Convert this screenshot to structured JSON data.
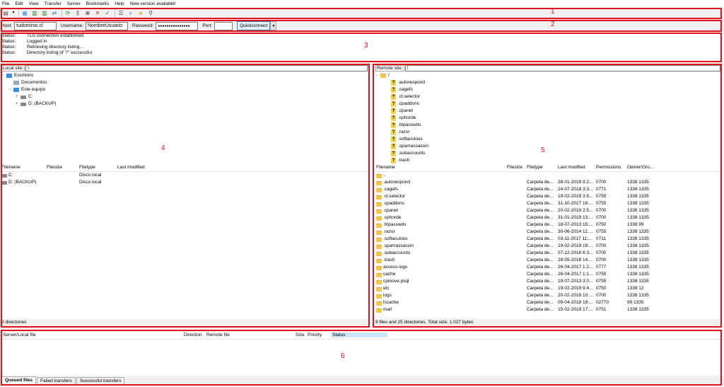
{
  "menu": [
    "File",
    "Edit",
    "View",
    "Transfer",
    "Server",
    "Bookmarks",
    "Help",
    "New version available!"
  ],
  "toolbar_icons": [
    "site-manager-icon",
    "dropdown-icon",
    "message-log-icon",
    "local-tree-icon",
    "remote-tree-icon",
    "transfer-queue-icon",
    "refresh-icon",
    "process-queue-icon",
    "cancel-icon",
    "disconnect-icon",
    "reconnect-icon",
    "filter-icon",
    "compare-icon",
    "sync-browse-icon",
    "search-icon"
  ],
  "quickconnect": {
    "host_label": "Host:",
    "host_value": "tudominio.cl",
    "user_label": "Username:",
    "user_value": "NombreUsuario",
    "pass_label": "Password:",
    "pass_value": "●●●●●●●●●●●●●●●",
    "port_label": "Port:",
    "port_value": "",
    "button": "Quickconnect"
  },
  "log": [
    {
      "k": "Status:",
      "v": "TLS connection established."
    },
    {
      "k": "Status:",
      "v": "Logged in"
    },
    {
      "k": "Status:",
      "v": "Retrieving directory listing..."
    },
    {
      "k": "Status:",
      "v": "Directory listing of \"/\" successful"
    }
  ],
  "local": {
    "site_label": "Local site:",
    "path": "\\",
    "tree": [
      {
        "name": "Escritorio",
        "icon": "pc",
        "lvl": 0,
        "exp": "−"
      },
      {
        "name": "Documentos",
        "icon": "doc",
        "lvl": 1,
        "exp": ""
      },
      {
        "name": "Este equipo",
        "icon": "pc",
        "lvl": 1,
        "exp": "−"
      },
      {
        "name": "C:",
        "icon": "drive",
        "lvl": 2,
        "exp": "+"
      },
      {
        "name": "D: (BACKUP)",
        "icon": "drive",
        "lvl": 2,
        "exp": "+"
      }
    ],
    "columns": [
      "Filename",
      "Filesize",
      "Filetype",
      "Last modified"
    ],
    "rows": [
      {
        "name": "C:",
        "type": "Disco local"
      },
      {
        "name": "D: (BACKUP)",
        "type": "Disco local"
      }
    ],
    "status": "2 directories"
  },
  "remote": {
    "site_label": "Remote site:",
    "path": "/",
    "tree_root": "/",
    "tree": [
      ".autorespond",
      ".cagefs",
      ".cl.selector",
      ".cpaddons",
      ".cpanel",
      ".cphorde",
      ".htpasswds",
      ".razor",
      ".softaculous",
      ".spamassassin",
      ".subaccounts",
      ".trash"
    ],
    "columns": [
      "Filename",
      "Filesize",
      "Filetype",
      "Last modified",
      "Permissions",
      "Owner/Gro..."
    ],
    "rows": [
      {
        "name": "..",
        "type": "",
        "mod": "",
        "perm": "",
        "owner": ""
      },
      {
        "name": ".autorespond",
        "type": "Carpeta de...",
        "mod": "28-01-2019 9:2...",
        "perm": "0700",
        "owner": "1338 1335"
      },
      {
        "name": ".cagefs",
        "type": "Carpeta de...",
        "mod": "24-07-2018 3:3...",
        "perm": "0771",
        "owner": "1338 1335"
      },
      {
        "name": ".cl.selector",
        "type": "Carpeta de...",
        "mod": "19-02-2019 3:5...",
        "perm": "0755",
        "owner": "1338 1335"
      },
      {
        "name": ".cpaddons",
        "type": "Carpeta de...",
        "mod": "31-10-2017 16:...",
        "perm": "0755",
        "owner": "1338 1335"
      },
      {
        "name": ".cpanel",
        "type": "Carpeta de...",
        "mod": "20-02-2019 2:5...",
        "perm": "0700",
        "owner": "1338 1335"
      },
      {
        "name": ".cphorde",
        "type": "Carpeta de...",
        "mod": "31-01-2019 13:...",
        "perm": "0700",
        "owner": "1338 1335"
      },
      {
        "name": ".htpasswds",
        "type": "Carpeta de...",
        "mod": "18-07-2013 15:...",
        "perm": "0750",
        "owner": "1338 99"
      },
      {
        "name": ".razor",
        "type": "Carpeta de...",
        "mod": "30-06-2014 11:...",
        "perm": "0755",
        "owner": "1338 1335"
      },
      {
        "name": ".softaculous",
        "type": "Carpeta de...",
        "mod": "03-11-2017 11:...",
        "perm": "0711",
        "owner": "1338 1335"
      },
      {
        "name": ".spamassassin",
        "type": "Carpeta de...",
        "mod": "19-02-2019 18:...",
        "perm": "0700",
        "owner": "1338 1335"
      },
      {
        "name": ".subaccounts",
        "type": "Carpeta de...",
        "mod": "07-12-2016 6:3...",
        "perm": "0700",
        "owner": "1338 1335"
      },
      {
        "name": ".trash",
        "type": "Carpeta de...",
        "mod": "28-05-2018 14:...",
        "perm": "0700",
        "owner": "1338 1335"
      },
      {
        "name": "access-logs",
        "type": "Carpeta de...",
        "mod": "26-04-2017 1:2...",
        "perm": "0777",
        "owner": "1338 1335"
      },
      {
        "name": "cache",
        "type": "Carpeta de...",
        "mod": "26-04-2017 1:1...",
        "perm": "0755",
        "owner": "1338 1335"
      },
      {
        "name": "cpmove.psql",
        "type": "Carpeta de...",
        "mod": "19-07-2013 3:0...",
        "perm": "0755",
        "owner": "1338 1335"
      },
      {
        "name": "etc",
        "type": "Carpeta de...",
        "mod": "19-02-2019 9:4...",
        "perm": "0750",
        "owner": "1338 12"
      },
      {
        "name": "logs",
        "type": "Carpeta de...",
        "mod": "20-02-2019 10:...",
        "perm": "0700",
        "owner": "1338 1335"
      },
      {
        "name": "lscache",
        "type": "Carpeta de...",
        "mod": "09-04-2018 19:...",
        "perm": "02770",
        "owner": "99 1335"
      },
      {
        "name": "mail",
        "type": "Carpeta de...",
        "mod": "15-02-2019 17:...",
        "perm": "0751",
        "owner": "1338 1335"
      }
    ],
    "status": "9 files and 25 directories. Total size: 1.027 bytes"
  },
  "queue": {
    "columns": [
      "Server/Local file",
      "Direction",
      "Remote file",
      "Size",
      "Priority",
      "Status"
    ],
    "tabs": [
      "Queued files",
      "Failed transfers",
      "Successful transfers"
    ]
  },
  "annotations": [
    "1",
    "2",
    "3",
    "4",
    "5",
    "6"
  ],
  "colors": {
    "annotation": "#e0111b",
    "folder": "#f3c74a",
    "accent": "#3c7fb1"
  }
}
